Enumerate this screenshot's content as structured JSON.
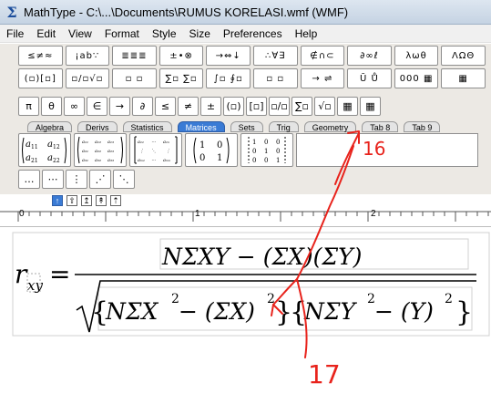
{
  "window": {
    "title": "MathType - C:\\...\\Documents\\RUMUS KORELASI.wmf (WMF)",
    "icon": "sigma-icon"
  },
  "menu": [
    "File",
    "Edit",
    "View",
    "Format",
    "Style",
    "Size",
    "Preferences",
    "Help"
  ],
  "palette_rows": [
    [
      "≤≠≈",
      "¡ab∵",
      "≣≣≣",
      "±•⊗",
      "→⇔↓",
      "∴∀∃",
      "∉∩⊂",
      "∂∞ℓ",
      "λωθ",
      "ΛΩΘ"
    ],
    [
      "(▫)[▫]",
      "▫/▫√▫",
      "▫ ▫",
      "∑▫ ∑▫",
      "∫▫ ∮▫",
      "▫ ▫",
      "→ ⇌",
      "Ū Ů",
      "000 ▦",
      "▦"
    ]
  ],
  "small_row": [
    "π",
    "θ",
    "∞",
    "∈",
    "→",
    "∂",
    "≤",
    "≠",
    "±",
    "(▫)",
    "[▫]",
    "▫/▫",
    "∑▫",
    "√▫",
    "▦",
    "▦"
  ],
  "tabs": [
    {
      "label": "Algebra",
      "active": false
    },
    {
      "label": "Derivs",
      "active": false
    },
    {
      "label": "Statistics",
      "active": false
    },
    {
      "label": "Matrices",
      "active": true
    },
    {
      "label": "Sets",
      "active": false
    },
    {
      "label": "Trig",
      "active": false
    },
    {
      "label": "Geometry",
      "active": false
    },
    {
      "label": "Tab 8",
      "active": false
    },
    {
      "label": "Tab 9",
      "active": false
    }
  ],
  "ruler_marks": [
    "0",
    "1",
    "2"
  ],
  "equation": {
    "lhs": "r",
    "lhs_sub": "xy",
    "numerator": "NΣXY − (ΣX)(ΣY)",
    "denominator_left": "NΣX",
    "denominator_left_rest": " − (ΣX)",
    "denominator_right": "NΣY",
    "denominator_right_rest": " − (Y)",
    "exponent": "2"
  },
  "annotations": {
    "label_16": "16",
    "label_17": "17",
    "color": "#e8231c"
  },
  "colors": {
    "accent": "#3a7bd5",
    "toolbar_bg": "#ece9e4"
  }
}
